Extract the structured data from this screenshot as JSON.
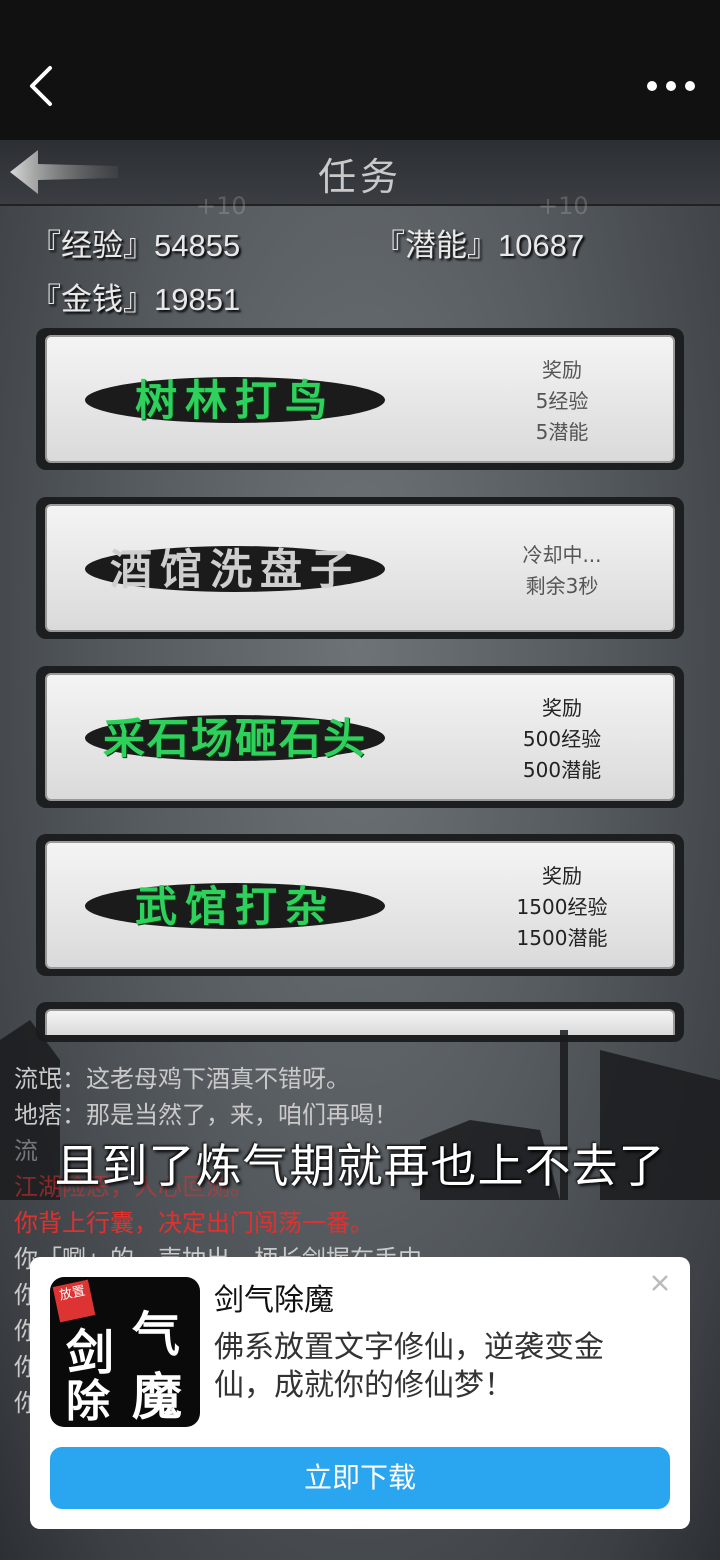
{
  "game": {
    "title": "任务",
    "faint_left": "+10",
    "faint_right": "+10",
    "stats": {
      "exp": "『经验』54855",
      "potential": "『潜能』10687",
      "money": "『金钱』19851"
    },
    "tasks": [
      {
        "name": "树林打鸟",
        "info": [
          "奖励",
          "5经验",
          "5潜能"
        ],
        "state": "available"
      },
      {
        "name": "酒馆洗盘子",
        "info": [
          "冷却中...",
          "剩余3秒"
        ],
        "state": "cooldown"
      },
      {
        "name": "采石场砸石头",
        "info": [
          "奖励",
          "500经验",
          "500潜能"
        ],
        "state": "available"
      },
      {
        "name": "武馆打杂",
        "info": [
          "奖励",
          "1500经验",
          "1500潜能"
        ],
        "state": "available"
      }
    ],
    "log": [
      {
        "text": "流氓：这老母鸡下酒真不错呀。",
        "style": "normal"
      },
      {
        "text": "地痞：那是当然了，来，咱们再喝！",
        "style": "normal"
      },
      {
        "text": "流",
        "style": "dim"
      },
      {
        "text": "江湖险恶，人心叵测。",
        "style": "red"
      },
      {
        "text": "你背上行囊，决定出门闯荡一番。",
        "style": "red"
      },
      {
        "text": "你「唰」的一声抽出一柄长剑握在手中。",
        "style": "normal"
      },
      {
        "text": "你",
        "style": "normal"
      },
      {
        "text": "你",
        "style": "normal"
      },
      {
        "text": "你",
        "style": "normal"
      },
      {
        "text": "你",
        "style": "normal"
      }
    ],
    "subtitle": "且到了炼气期就再也上不去了"
  },
  "ad": {
    "title": "剑气除魔",
    "description": "佛系放置文字修仙，逆袭变金仙，成就你的修仙梦！",
    "button_label": "立即下载",
    "logo_tag": "放置",
    "logo_chars": [
      "剑",
      "气",
      "除",
      "魔"
    ]
  },
  "colors": {
    "accent_button": "#2aa5f0",
    "task_green": "#2fd15d",
    "log_red": "#e0312f"
  }
}
